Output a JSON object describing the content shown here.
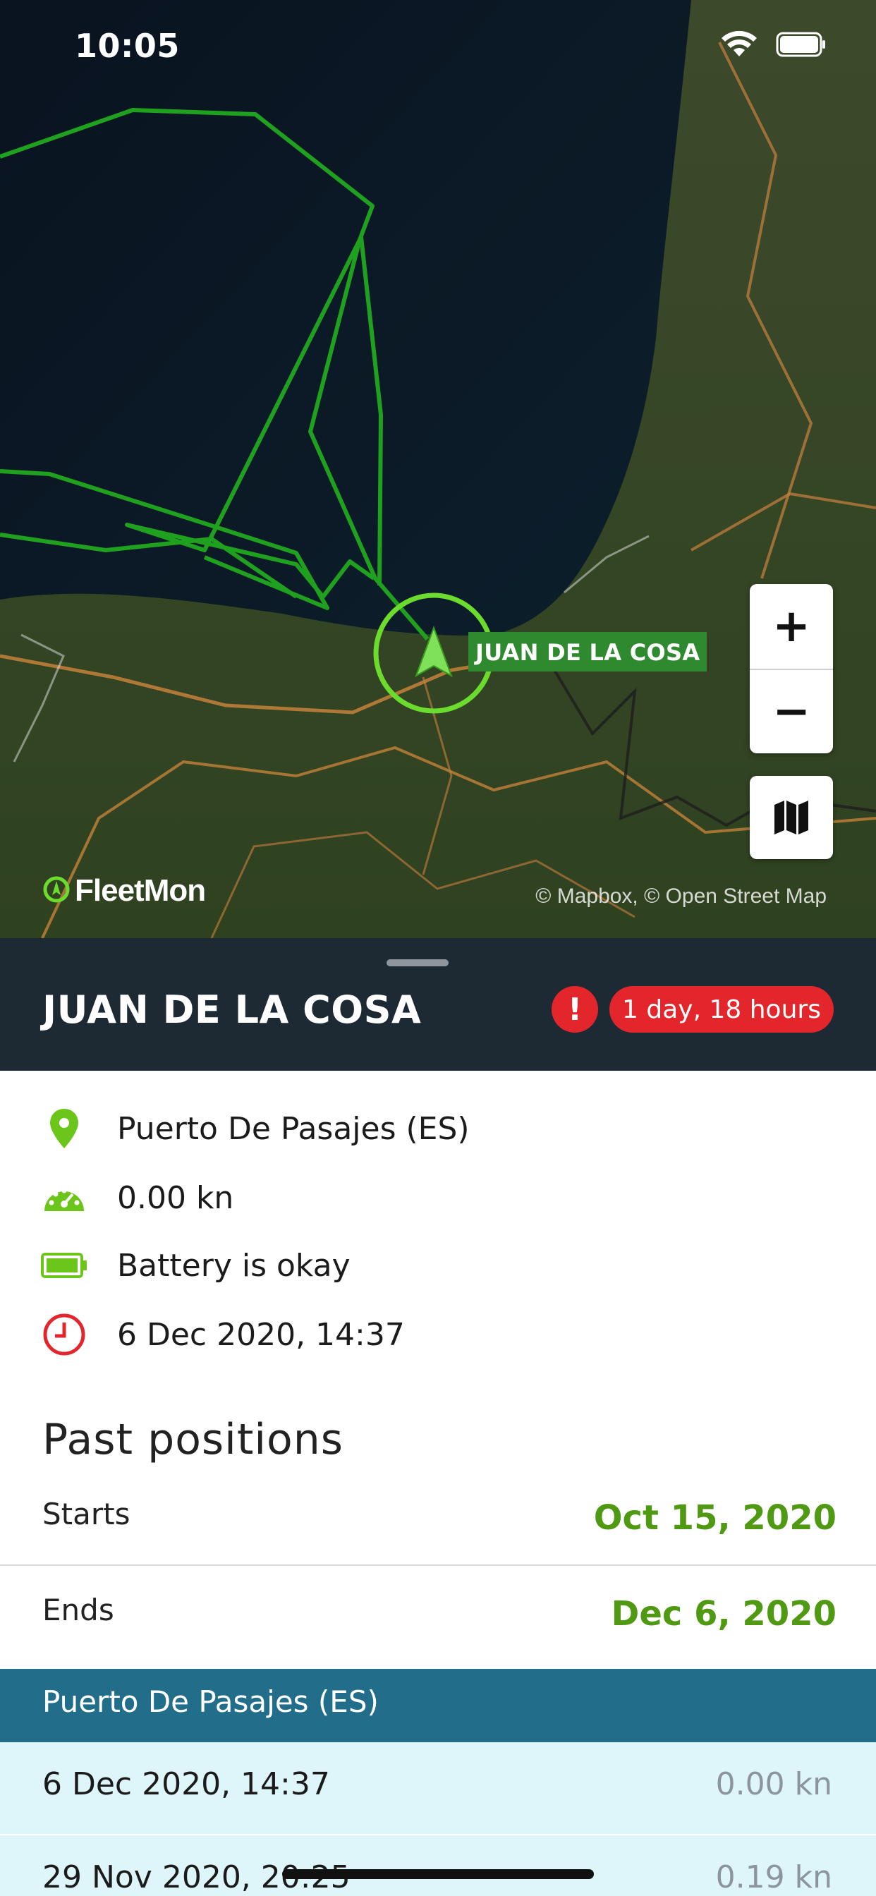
{
  "status_bar": {
    "time": "10:05"
  },
  "map": {
    "vessel_label": "JUAN DE LA COSA",
    "zoom_in_label": "+",
    "zoom_out_label": "−",
    "logo_text": "FleetMon",
    "attribution": "© Mapbox, © Open Street Map",
    "track_color": "#1fa01f",
    "marker_color": "#6bdc2e"
  },
  "header": {
    "vessel_name": "JUAN DE LA COSA",
    "alert_symbol": "!",
    "age_badge": "1 day, 18 hours"
  },
  "info": {
    "location": "Puerto De Pasajes (ES)",
    "speed": "0.00 kn",
    "battery": "Battery is okay",
    "timestamp": "6 Dec 2020, 14:37",
    "icons": [
      "location-pin-icon",
      "speedometer-icon",
      "battery-icon",
      "clock-icon"
    ]
  },
  "past_positions": {
    "title": "Past positions",
    "starts_label": "Starts",
    "starts_value": "Oct 15, 2020",
    "ends_label": "Ends",
    "ends_value": "Dec 6, 2020",
    "group_header": "Puerto De Pasajes (ES)",
    "rows": [
      {
        "date": "6 Dec 2020, 14:37",
        "speed": "0.00 kn"
      },
      {
        "date": "29 Nov 2020, 20:25",
        "speed": "0.19 kn"
      }
    ]
  },
  "colors": {
    "accent_green": "#4f9a12",
    "header_bg": "#1d2a33",
    "alert_red": "#e3262b",
    "group_header_bg": "#226e8a",
    "row_bg": "#def5f9"
  }
}
